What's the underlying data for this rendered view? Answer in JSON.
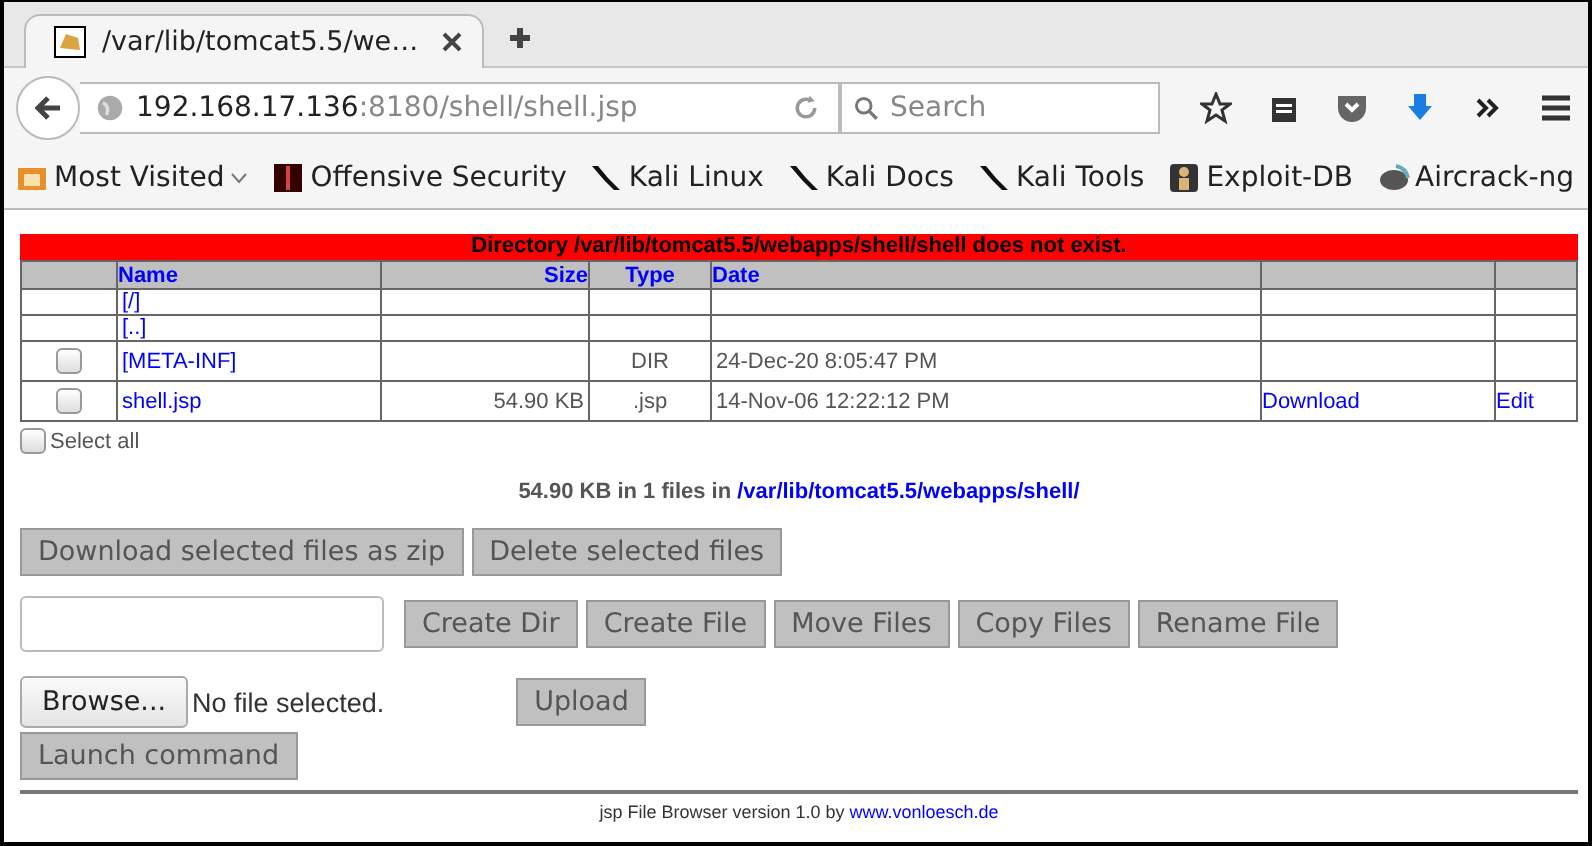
{
  "browser": {
    "tab": {
      "title": "/var/lib/tomcat5.5/we…",
      "selected": true
    },
    "address": {
      "host": "192.168.17.136",
      "path": ":8180/shell/shell.jsp"
    },
    "search": {
      "placeholder": "Search"
    },
    "bookmarks": [
      {
        "label": "Most Visited",
        "kind": "folder"
      },
      {
        "label": "Offensive Security",
        "kind": "offsec"
      },
      {
        "label": "Kali Linux",
        "kind": "kali"
      },
      {
        "label": "Kali Docs",
        "kind": "kali"
      },
      {
        "label": "Kali Tools",
        "kind": "kali"
      },
      {
        "label": "Exploit-DB",
        "kind": "exploitdb"
      },
      {
        "label": "Aircrack-ng",
        "kind": "aircrack"
      }
    ]
  },
  "page": {
    "error": "Directory /var/lib/tomcat5.5/webapps/shell/shell does not exist.",
    "columns": [
      "Name",
      "Size",
      "Type",
      "Date"
    ],
    "rows": [
      {
        "kind": "nav",
        "name": "[/]"
      },
      {
        "kind": "nav",
        "name": "[..]"
      },
      {
        "kind": "entry",
        "checked": false,
        "name": "[META-INF]",
        "type": "DIR",
        "date": "24-Dec-20 8:05:47 PM"
      },
      {
        "kind": "entry",
        "checked": false,
        "name": "shell.jsp",
        "size": "54.90 KB",
        "type": ".jsp",
        "date": "14-Nov-06 12:22:12 PM",
        "actions": [
          "Download",
          "Edit"
        ]
      }
    ],
    "select_all": {
      "label": "Select all",
      "checked": false
    },
    "summary": {
      "text": "54.90 KB in 1 files in ",
      "path": "/var/lib/tomcat5.5/webapps/shell/"
    },
    "bulk_buttons": [
      "Download selected files as zip",
      "Delete selected files"
    ],
    "file_buttons": [
      "Create Dir",
      "Create File",
      "Move Files",
      "Copy Files",
      "Rename File"
    ],
    "browse": {
      "button": "Browse...",
      "status": "No file selected."
    },
    "upload": "Upload",
    "launch": "Launch command",
    "footer": {
      "text": "jsp File Browser version 1.0 by ",
      "link": "www.vonloesch.de"
    }
  }
}
